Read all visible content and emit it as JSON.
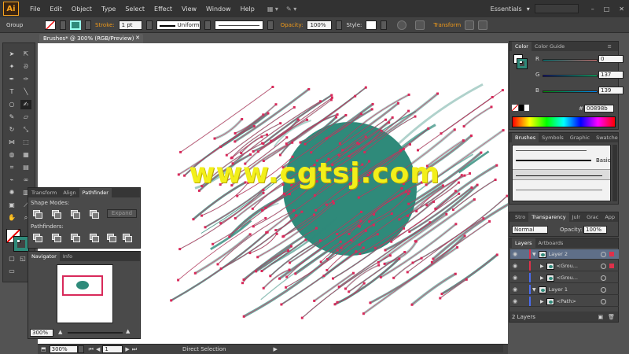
{
  "app": {
    "logo_text": "Ai",
    "menu": [
      "File",
      "Edit",
      "Object",
      "Type",
      "Select",
      "Effect",
      "View",
      "Window",
      "Help"
    ],
    "workspace": "Essentials",
    "window_controls": [
      "–",
      "□",
      "✕"
    ]
  },
  "control_bar": {
    "selection_label": "Group",
    "stroke_label": "Stroke:",
    "stroke_weight": "1 pt",
    "stroke_profile": "Uniform",
    "opacity_label": "Opacity:",
    "opacity_value": "100%",
    "style_label": "Style:",
    "transform_label": "Transform"
  },
  "document": {
    "tab_title": "Brushes* @ 300% (RGB/Preview)",
    "close_glyph": "✕"
  },
  "watermark": "www.cgtsj.com",
  "color_panel": {
    "tabs": [
      "Color",
      "Color Guide"
    ],
    "r_label": "R",
    "r_value": "0",
    "g_label": "G",
    "g_value": "137",
    "b_label": "B",
    "b_value": "139",
    "hex_prefix": "#",
    "hex_value": "00898b",
    "r_level": 0,
    "g_level": 137,
    "b_level": 139
  },
  "brushes_panel": {
    "tabs": [
      "Brushes",
      "Symbols",
      "Graphic",
      "Swatche"
    ],
    "basic_label": "Basic"
  },
  "transparency_panel": {
    "tabs": [
      "Stro",
      "Transparency",
      "Julr",
      "Grac",
      "App"
    ],
    "mode": "Normal",
    "opacity_label": "Opacity:",
    "opacity_value": "100%"
  },
  "layers_panel": {
    "tabs": [
      "Layers",
      "Artboards"
    ],
    "rows": [
      {
        "name": "Layer 2",
        "level": 0,
        "expanded": true,
        "selected": true,
        "color": "#e0304a"
      },
      {
        "name": "<Grou...",
        "level": 1,
        "expanded": false,
        "selected": false,
        "color": "#e0304a"
      },
      {
        "name": "<Grou...",
        "level": 1,
        "expanded": false,
        "selected": false,
        "color": ""
      },
      {
        "name": "Layer 1",
        "level": 0,
        "expanded": true,
        "selected": false,
        "color": "#4a6cf0"
      },
      {
        "name": "<Path>",
        "level": 1,
        "expanded": false,
        "selected": false,
        "color": ""
      }
    ],
    "footer": "2 Layers"
  },
  "pathfinder_panel": {
    "tabs": [
      "Transform",
      "Align",
      "Pathfinder"
    ],
    "shape_modes_label": "Shape Modes:",
    "expand_label": "Expand",
    "pathfinders_label": "Pathfinders:"
  },
  "navigator_panel": {
    "tabs": [
      "Navigator",
      "Info"
    ],
    "zoom": "300%"
  },
  "status_bar": {
    "zoom": "300%",
    "artboard": "1",
    "tool": "Direct Selection"
  },
  "colors": {
    "accent_teal": "#2f8a7a",
    "anchor_pink": "#d8295a",
    "watermark_yellow": "#f2ef1a"
  }
}
